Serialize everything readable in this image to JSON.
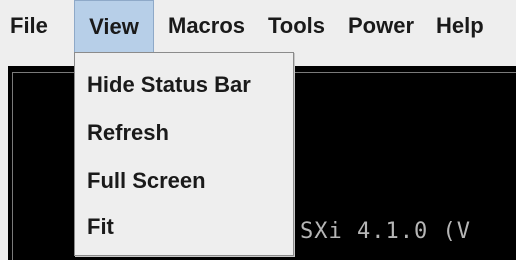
{
  "menubar": {
    "items": [
      {
        "label": "File"
      },
      {
        "label": "View"
      },
      {
        "label": "Macros"
      },
      {
        "label": "Tools"
      },
      {
        "label": "Power"
      },
      {
        "label": "Help"
      }
    ]
  },
  "dropdown": {
    "items": [
      {
        "label": "Hide Status Bar"
      },
      {
        "label": "Refresh"
      },
      {
        "label": "Full Screen"
      },
      {
        "label": "Fit"
      }
    ]
  },
  "console": {
    "text": "SXi 4.1.0 (V"
  },
  "colors": {
    "menubar_bg": "#eeeeee",
    "active_menu_bg": "#b7cfe8",
    "console_bg": "#000000",
    "console_text": "#b6b6b6"
  }
}
